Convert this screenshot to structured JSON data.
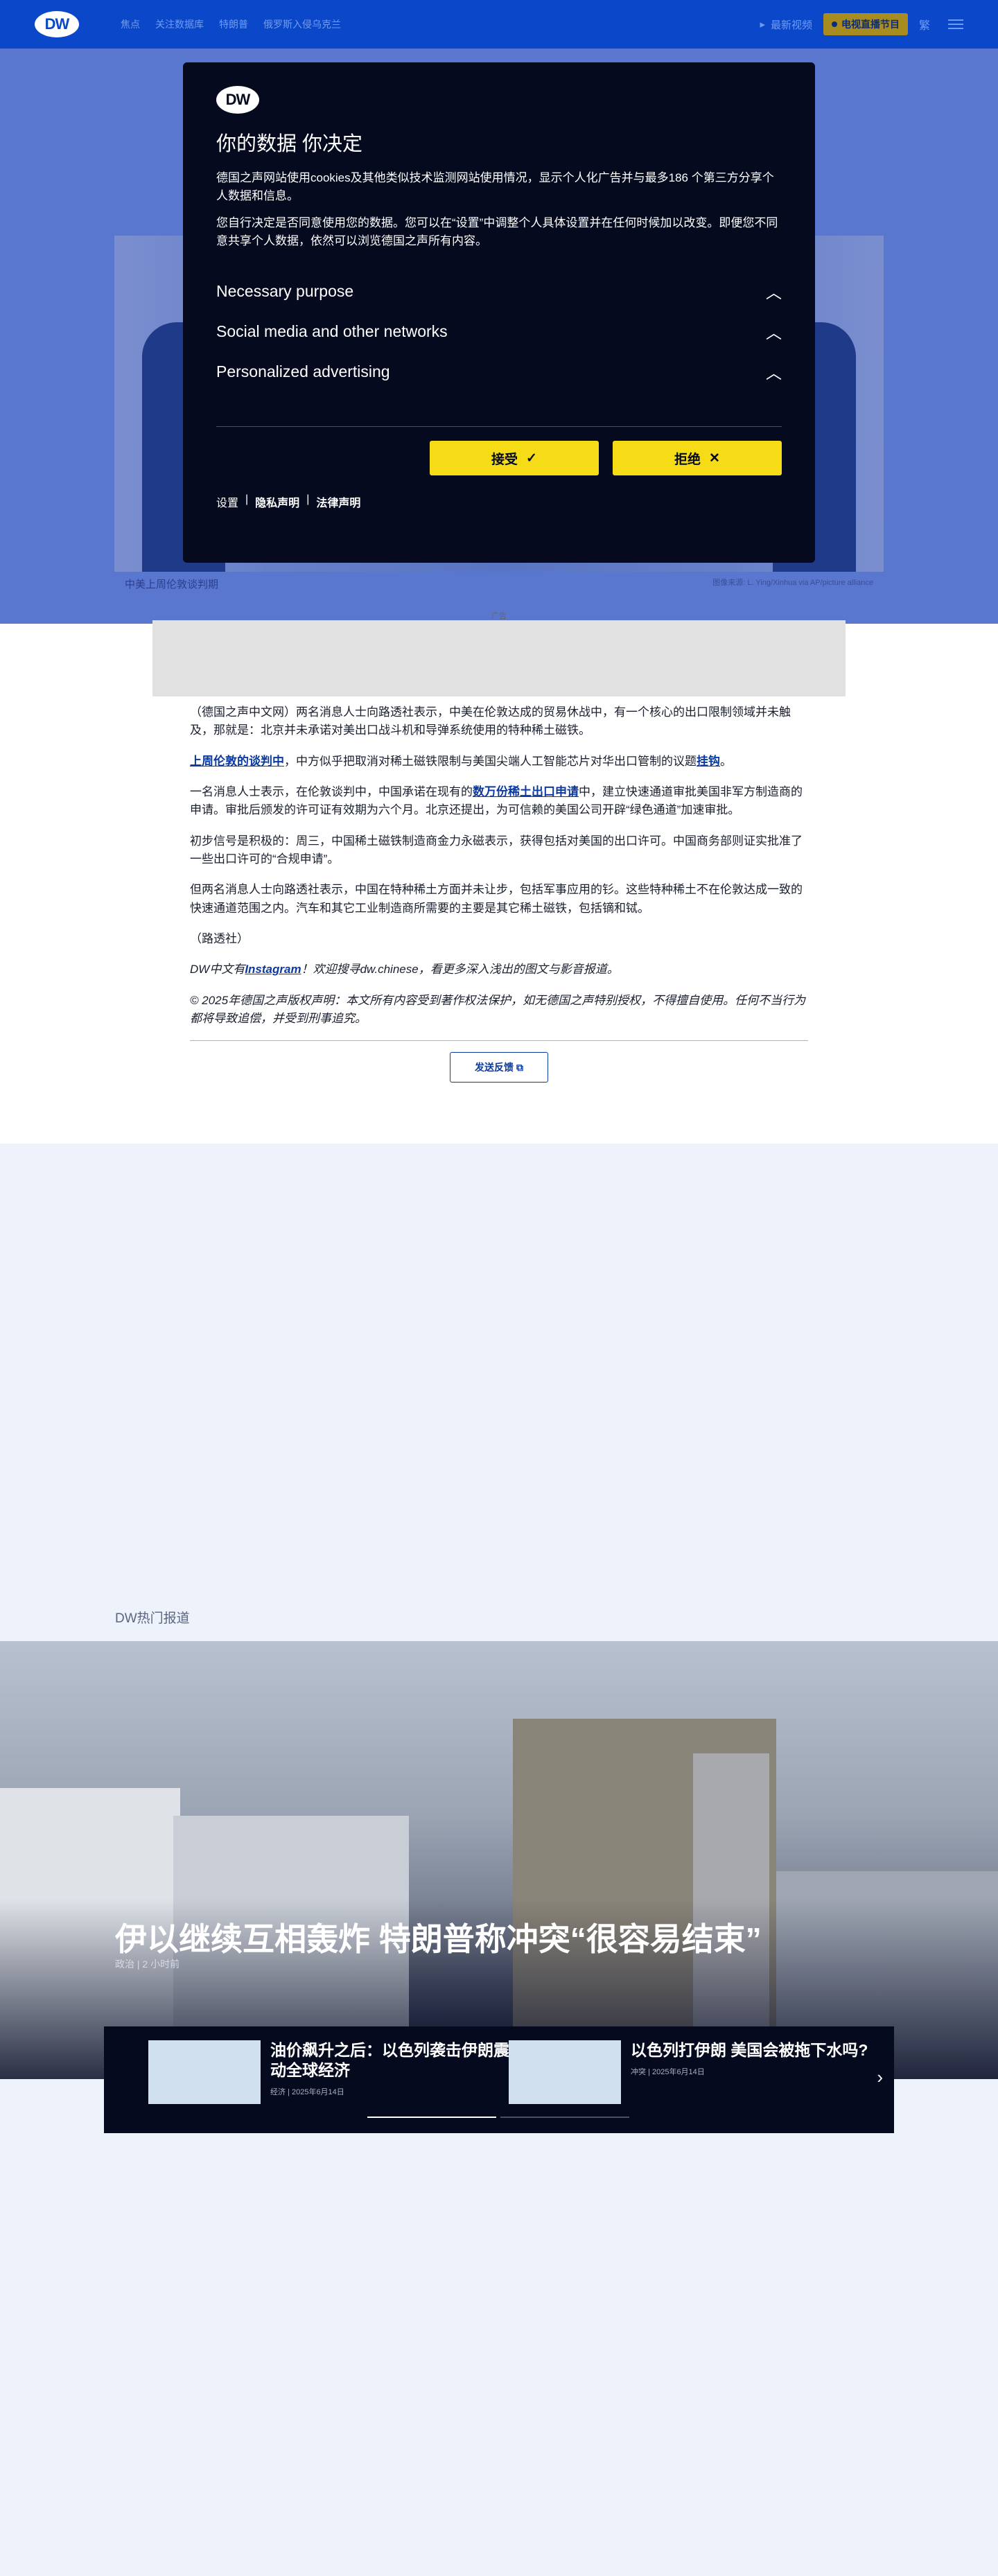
{
  "nav": {
    "logo": "DW",
    "items": [
      "焦点",
      "关注数据库",
      "特朗普",
      "俄罗斯入侵乌克兰"
    ],
    "latest_video": "最新视频",
    "live": "电视直播节目",
    "lang": "繁",
    "colors": {
      "bar": "#0b48c9",
      "live_badge": "#a88c1f"
    }
  },
  "hero": {
    "caption": "中美上周伦敦谈判期",
    "credit": "图像来源: L. Ying/Xinhua via AP/picture alliance"
  },
  "ad": {
    "label": "广告"
  },
  "article": {
    "p1": "（德国之声中文网）两名消息人士向路透社表示，中美在伦敦达成的贸易休战中，有一个核心的出口限制领域并未触及，那就是：北京并未承诺对美出口战斗机和导弹系统使用的特种稀土磁铁。",
    "p2_link1": "上周伦敦的谈判中",
    "p2_mid": "，中方似乎把取消对稀土磁铁限制与美国尖端人工智能芯片对华出口管制的议题",
    "p2_link2": "挂钩",
    "p2_end": "。",
    "p3_a": "一名消息人士表示，在伦敦谈判中，中国承诺在现有的",
    "p3_link": "数万份稀土出口申请",
    "p3_b": "中，建立快速通道审批美国非军方制造商的申请。审批后颁发的许可证有效期为六个月。北京还提出，为可信赖的美国公司开辟“绿色通道”加速审批。",
    "p4": "初步信号是积极的：周三，中国稀土磁铁制造商金力永磁表示，获得包括对美国的出口许可。中国商务部则证实批准了一些出口许可的“合规申请”。",
    "p5": "但两名消息人士向路透社表示，中国在特种稀土方面并未让步，包括军事应用的钐。这些特种稀土不在伦敦达成一致的快速通道范围之内。汽车和其它工业制造商所需要的主要是其它稀土磁铁，包括镝和铽。",
    "p6": "（路透社）",
    "p7_a": "DW中文有",
    "p7_link": "Instagram",
    "p7_b": "！欢迎搜寻dw.chinese，看更多深入浅出的图文与影音报道。",
    "p8": "© 2025年德国之声版权声明：本文所有内容受到著作权法保护，如无德国之声特别授权，不得擅自使用。任何不当行为都将导致追偿，并受到刑事追究。",
    "feedback": "发送反馈"
  },
  "top_stories": {
    "section": "DW热门报道",
    "headline": "伊以继续互相轰炸 特朗普称冲突“很容易结束”",
    "meta": "政治 | 2 小时前",
    "cards": [
      {
        "title": "油价飙升之后：以色列袭击伊朗震动全球经济",
        "meta": "经济 | 2025年6月14日"
      },
      {
        "title": "以色列打伊朗 美国会被拖下水吗?",
        "meta": "冲突 | 2025年6月14日"
      }
    ]
  },
  "consent": {
    "logo": "DW",
    "title": "你的数据 你决定",
    "intro1": "德国之声网站使用cookies及其他类似技术监测网站使用情况，显示个人化广告并与最多186 个第三方分享个人数据和信息。",
    "intro2": "您自行决定是否同意使用您的数据。您可以在“设置”中调整个人具体设置并在任何时候加以改变。即便您不同意共享个人数据，依然可以浏览德国之声所有内容。",
    "items": [
      "Necessary purpose",
      "Social media and other networks",
      "Personalized advertising"
    ],
    "accept": "接受",
    "reject": "拒绝",
    "links": [
      "设置",
      "隐私声明",
      "法律声明"
    ],
    "colors": {
      "panel": "#050a1f",
      "button": "#f5dc16"
    }
  }
}
